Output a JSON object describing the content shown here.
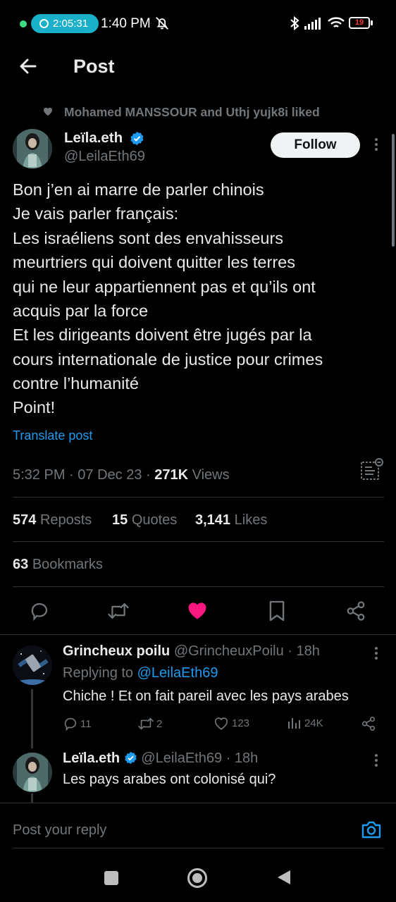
{
  "status_bar": {
    "timer": "2:05:31",
    "time": "1:40 PM",
    "battery": "19"
  },
  "header": {
    "title": "Post"
  },
  "social_context": "Mohamed MANSSOUR and Uthj yujk8i liked",
  "tweet": {
    "author_name": "Leïla.eth",
    "author_handle": "@LeilaEth69",
    "follow_label": "Follow",
    "text_lines": [
      "Bon j’en ai marre de parler chinois",
      "Je vais parler français:",
      "Les israéliens sont des envahisseurs",
      "meurtriers qui doivent quitter les terres",
      "qui ne leur appartiennent pas et qu’ils ont",
      "acquis par la force",
      "Et les dirigeants doivent être jugés par la",
      "cours internationale de justice pour crimes",
      "contre l’humanité",
      "Point!"
    ],
    "translate_label": "Translate post",
    "time": "5:32 PM",
    "date": "07 Dec 23",
    "views_count": "271K",
    "views_label": "Views",
    "reposts_count": "574",
    "reposts_label": "Reposts",
    "quotes_count": "15",
    "quotes_label": "Quotes",
    "likes_count": "3,141",
    "likes_label": "Likes",
    "bookmarks_count": "63",
    "bookmarks_label": "Bookmarks",
    "like_color": "#f91880"
  },
  "replies": [
    {
      "name": "Grincheux poilu",
      "handle": "@GrincheuxPoilu",
      "age": "18h",
      "replying_prefix": "Replying to",
      "replying_to": "@LeilaEth69",
      "text": "Chiche ! Et on fait pareil avec les pays arabes",
      "replies": "11",
      "reposts": "2",
      "likes": "123",
      "views": "24K"
    },
    {
      "name": "Leïla.eth",
      "handle": "@LeilaEth69",
      "age": "18h",
      "text": "Les pays arabes ont colonisé qui?"
    }
  ],
  "composer": {
    "placeholder": "Post your reply"
  },
  "colors": {
    "accent": "#1d9bf0",
    "muted": "#71767b",
    "background": "#000000"
  }
}
